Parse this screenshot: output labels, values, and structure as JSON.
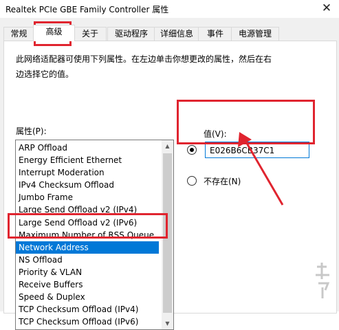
{
  "window": {
    "title": "Realtek PCIe GBE Family Controller 属性"
  },
  "tabs": [
    {
      "label": "常规"
    },
    {
      "label": "高级"
    },
    {
      "label": "关于"
    },
    {
      "label": "驱动程序"
    },
    {
      "label": "详细信息"
    },
    {
      "label": "事件"
    },
    {
      "label": "电源管理"
    }
  ],
  "advanced": {
    "description_line1": "此网络适配器可使用下列属性。在左边单击你想更改的属性，然后在右",
    "description_line2": "边选择它的值。",
    "properties_label": "属性(P):",
    "properties": [
      "ARP Offload",
      "Energy Efficient Ethernet",
      "Interrupt Moderation",
      "IPv4 Checksum Offload",
      "Jumbo Frame",
      "Large Send Offload v2 (IPv4)",
      "Large Send Offload v2 (IPv6)",
      "Maximum Number of RSS Queue",
      "Network Address",
      "NS Offload",
      "Priority & VLAN",
      "Receive Buffers",
      "Speed & Duplex",
      "TCP Checksum Offload (IPv4)",
      "TCP Checksum Offload (IPv6)"
    ],
    "selected_property": "Network Address",
    "value_label": "值(V):",
    "value": "E026B6CB37C1",
    "not_present_label": "不存在(N)"
  },
  "annotation": {
    "color": "#e0242f"
  },
  "colors": {
    "selection": "#0078d7"
  }
}
